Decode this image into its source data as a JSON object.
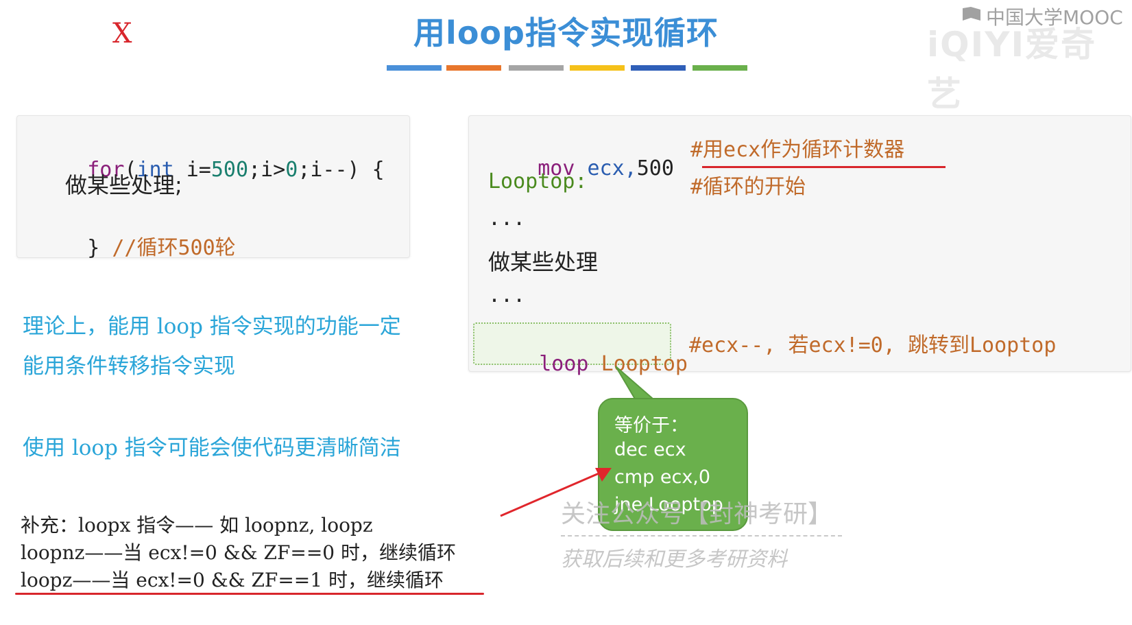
{
  "title": "用loop指令实现循环",
  "annotation_x": "X",
  "color_bars": [
    "#4a90d9",
    "#e8762c",
    "#a5a5a5",
    "#f5c11a",
    "#2f5fb8",
    "#6ab04c"
  ],
  "watermark": {
    "mooc": "中国大学MOOC",
    "iqiyi": "iQIYI爱奇艺",
    "account": "关注公众号【封神考研】",
    "more": "获取后续和更多考研资料"
  },
  "left_code": {
    "for_kw": "for",
    "paren_open": "(",
    "int_kw": "int",
    "init": " i=",
    "init_val": "500",
    "cond": ";i>",
    "cond_val": "0",
    "step": ";i--)",
    "brace_open": " {",
    "body": "做某些处理;",
    "brace_close": "}",
    "comment": "//循环500轮"
  },
  "right_code": {
    "mov_kw": "mov",
    "mov_operands": " ecx,",
    "mov_val": "500",
    "mov_comment": "#用ecx作为循环计数器",
    "label": "Looptop:",
    "label_comment": "#循环的开始",
    "ellipsis1": "...",
    "body": "做某些处理",
    "ellipsis2": "...",
    "loop_kw": "loop",
    "loop_target": "Looptop",
    "loop_comment": "#ecx--, 若ecx!=0, 跳转到Looptop"
  },
  "notes": {
    "line1": "理论上，能用 loop 指令实现的功能一定",
    "line2": "能用条件转移指令实现",
    "line3": "使用 loop 指令可能会使代码更清晰简洁"
  },
  "supplement": {
    "line1": "补充：loopx 指令—— 如 loopnz, loopz",
    "line2": "loopnz——当 ecx!=0 && ZF==0 时，继续循环",
    "line3": "loopz——当 ecx!=0 && ZF==1 时，继续循环"
  },
  "callout": {
    "line1": "等价于：",
    "line2": "dec ecx",
    "line3": "cmp ecx,0",
    "line4": "jne Looptop"
  }
}
